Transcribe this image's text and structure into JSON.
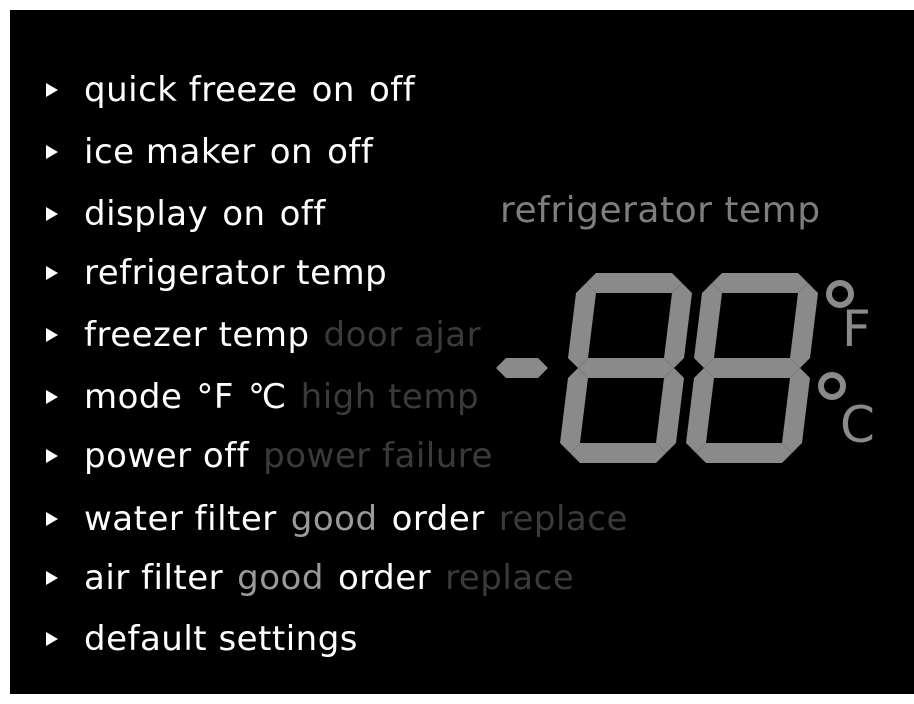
{
  "menu": [
    {
      "label": "quick freeze",
      "on": "on",
      "off": "off"
    },
    {
      "label": "ice maker",
      "on": "on",
      "off": "off"
    },
    {
      "label": "display",
      "on": "on",
      "off": "off"
    },
    {
      "label": "refrigerator temp"
    },
    {
      "label": "freezer temp",
      "indicator": "door ajar"
    },
    {
      "label": "mode",
      "unit_f": "°F",
      "unit_c": "℃",
      "indicator": "high temp"
    },
    {
      "label": "power off",
      "indicator": "power failure"
    },
    {
      "label": "water filter",
      "good": "good",
      "order": "order",
      "replace": "replace"
    },
    {
      "label": "air filter",
      "good": "good",
      "order": "order",
      "replace": "replace"
    },
    {
      "label": "default settings"
    }
  ],
  "display": {
    "title": "refrigerator temp",
    "sign": "-",
    "digits": "88",
    "unit_f": "F",
    "unit_c": "C"
  },
  "colors": {
    "background": "#000000",
    "text": "#ffffff",
    "segment": "#8a8a8a",
    "indicator_dim": "#3a3a3a",
    "good": "#9a9a9a"
  }
}
